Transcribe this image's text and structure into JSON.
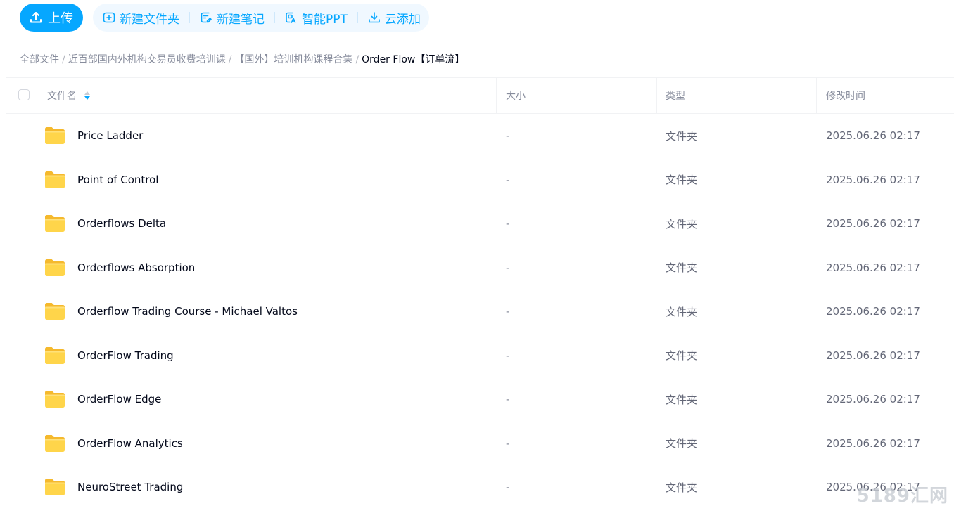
{
  "toolbar": {
    "upload_label": "上传",
    "actions": [
      {
        "label": "新建文件夹",
        "icon": "new-folder-icon"
      },
      {
        "label": "新建笔记",
        "icon": "new-note-icon"
      },
      {
        "label": "智能PPT",
        "icon": "smart-ppt-icon"
      },
      {
        "label": "云添加",
        "icon": "cloud-add-icon"
      }
    ],
    "accent_color": "#06a7ff"
  },
  "breadcrumb": {
    "items": [
      "全部文件",
      "近百部国内外机构交易员收费培训课",
      "【国外】培训机构课程合集"
    ],
    "current": "Order Flow【订单流】"
  },
  "table": {
    "headers": {
      "name": "文件名",
      "size": "大小",
      "type": "类型",
      "modified": "修改时间"
    },
    "rows": [
      {
        "name": "Price Ladder",
        "size": "-",
        "type": "文件夹",
        "modified": "2025.06.26 02:17"
      },
      {
        "name": "Point of Control",
        "size": "-",
        "type": "文件夹",
        "modified": "2025.06.26 02:17"
      },
      {
        "name": "Orderflows Delta",
        "size": "-",
        "type": "文件夹",
        "modified": "2025.06.26 02:17"
      },
      {
        "name": "Orderflows Absorption",
        "size": "-",
        "type": "文件夹",
        "modified": "2025.06.26 02:17"
      },
      {
        "name": "Orderflow Trading Course - Michael Valtos",
        "size": "-",
        "type": "文件夹",
        "modified": "2025.06.26 02:17"
      },
      {
        "name": "OrderFlow Trading",
        "size": "-",
        "type": "文件夹",
        "modified": "2025.06.26 02:17"
      },
      {
        "name": "OrderFlow Edge",
        "size": "-",
        "type": "文件夹",
        "modified": "2025.06.26 02:17"
      },
      {
        "name": "OrderFlow Analytics",
        "size": "-",
        "type": "文件夹",
        "modified": "2025.06.26 02:17"
      },
      {
        "name": "NeuroStreet Trading",
        "size": "-",
        "type": "文件夹",
        "modified": "2025.06.26 02:17"
      }
    ]
  },
  "watermark": "5189汇网"
}
